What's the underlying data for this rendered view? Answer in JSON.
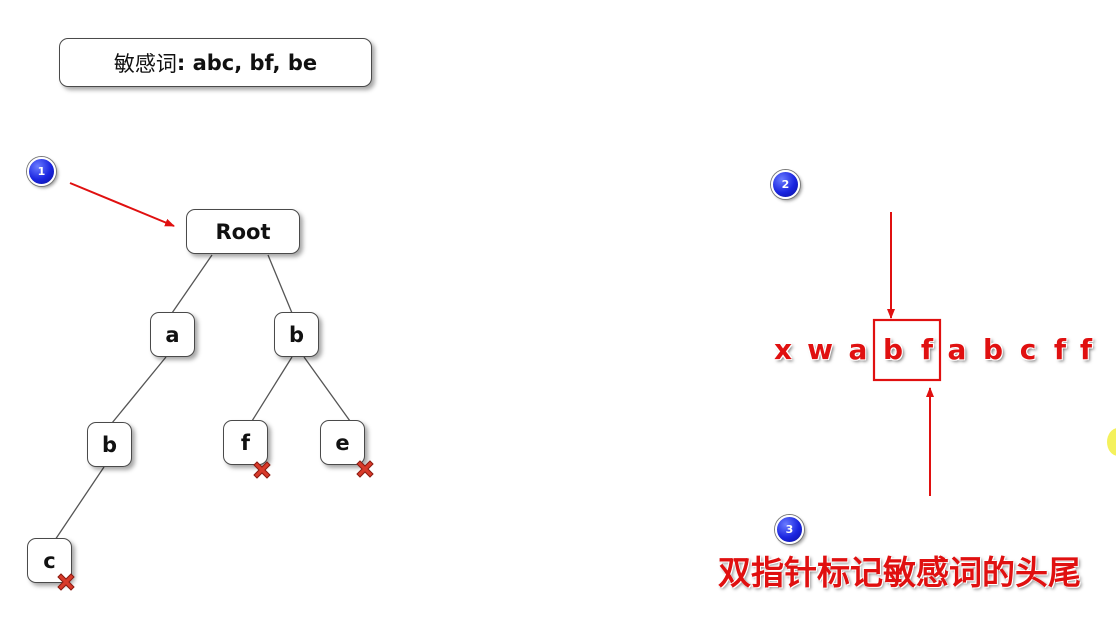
{
  "title": {
    "label": "敏感词",
    "words": ": abc, bf, be"
  },
  "tree": {
    "root": "Root",
    "nodes": {
      "a": "a",
      "b1": "b",
      "b2": "b",
      "f": "f",
      "e": "e",
      "c": "c"
    }
  },
  "badges": [
    "1",
    "2",
    "3"
  ],
  "sequence": [
    "x",
    "w",
    "a",
    "b",
    "f",
    "a",
    "b",
    "c",
    "f",
    "f"
  ],
  "caption": "双指针标记敏感词的头尾",
  "colors": {
    "accent": "#e01010",
    "badge": "#1a25e0",
    "node_border": "#4a4a4a"
  }
}
